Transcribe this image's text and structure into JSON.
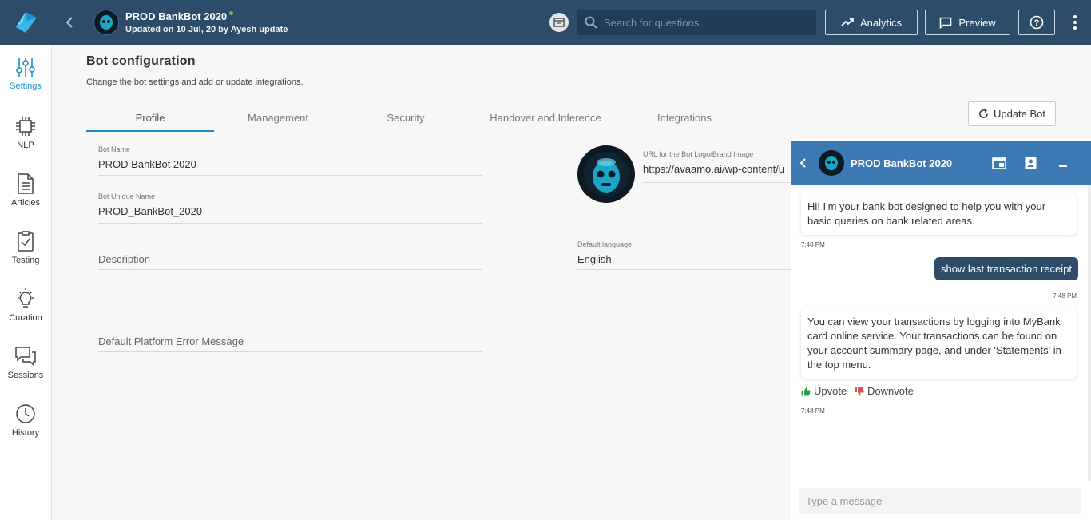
{
  "header": {
    "bot_name": "PROD BankBot 2020",
    "updated": "Updated on 10 Jul, 20 by Ayesh update",
    "search_placeholder": "Search for questions",
    "analytics_label": "Analytics",
    "preview_label": "Preview"
  },
  "sidebar": {
    "items": [
      {
        "label": "Settings",
        "icon": "settings-sliders-icon",
        "active": true
      },
      {
        "label": "NLP",
        "icon": "chip-icon"
      },
      {
        "label": "Articles",
        "icon": "document-icon"
      },
      {
        "label": "Testing",
        "icon": "clipboard-check-icon"
      },
      {
        "label": "Curation",
        "icon": "lightbulb-icon"
      },
      {
        "label": "Sessions",
        "icon": "chat-bubbles-icon"
      },
      {
        "label": "History",
        "icon": "clock-icon"
      }
    ]
  },
  "main": {
    "title": "Bot configuration",
    "subtitle": "Change the bot settings and add or update integrations.",
    "tabs": [
      "Profile",
      "Management",
      "Security",
      "Handover and Inference",
      "Integrations"
    ],
    "active_tab": "Profile",
    "update_button": "Update Bot",
    "fields": {
      "bot_name_label": "Bot Name",
      "bot_name_value": "PROD BankBot 2020",
      "unique_name_label": "Bot Unique Name",
      "unique_name_value": "PROD_BankBot_2020",
      "description_placeholder": "Description",
      "error_msg_placeholder": "Default Platform Error Message",
      "logo_url_label": "URL for the Bot Logo/Brand Image",
      "logo_url_value": "https://avaamo.ai/wp-content/u",
      "language_label": "Default language",
      "language_value": "English"
    }
  },
  "chat": {
    "title": "PROD BankBot 2020",
    "messages": [
      {
        "from": "bot",
        "text": "Hi! I'm your bank bot designed to help you with your basic queries on bank related areas.",
        "time": "7:48 PM"
      },
      {
        "from": "user",
        "text": "show last transaction receipt",
        "time": "7:48 PM"
      },
      {
        "from": "bot",
        "text": "You can view your transactions by logging into MyBank card online service. Your transactions can be found on your account summary page, and under 'Statements' in the top menu.",
        "time": "7:48 PM"
      }
    ],
    "upvote": "Upvote",
    "downvote": "Downvote",
    "input_placeholder": "Type a message"
  },
  "colors": {
    "topbar": "#2d4c6a",
    "accent": "#1a8fc7",
    "chat_header": "#3d7ab3",
    "online_dot": "#6cc04a",
    "upvote": "#2e9e4f",
    "downvote": "#d9534f"
  }
}
